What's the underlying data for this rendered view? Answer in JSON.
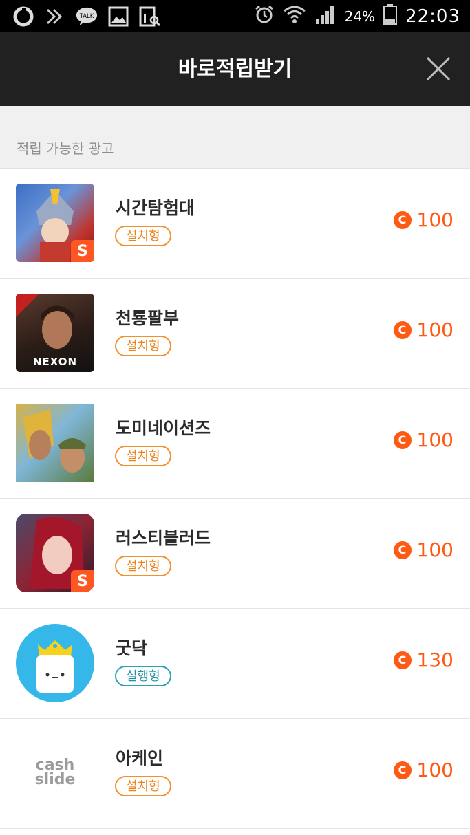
{
  "status_bar": {
    "talk_label": "TALK",
    "battery": "24%",
    "time": "22:03"
  },
  "header": {
    "title": "바로적립받기"
  },
  "section": {
    "label": "적립 가능한 광고"
  },
  "ads": [
    {
      "name": "시간탐험대",
      "type": "설치형",
      "reward": "100",
      "icon": "game-hero-icon",
      "badge_color": "orange"
    },
    {
      "name": "천룡팔부",
      "type": "설치형",
      "reward": "100",
      "icon": "nexon-game-icon",
      "brand": "NEXON",
      "badge_color": "orange"
    },
    {
      "name": "도미네이션즈",
      "type": "설치형",
      "reward": "100",
      "icon": "dominations-icon",
      "badge_color": "orange"
    },
    {
      "name": "러스티블러드",
      "type": "설치형",
      "reward": "100",
      "icon": "rusty-blood-icon",
      "badge_color": "orange"
    },
    {
      "name": "굿닥",
      "type": "실행형",
      "reward": "130",
      "icon": "goodoc-icon",
      "badge_color": "teal"
    },
    {
      "name": "아케인",
      "type": "설치형",
      "reward": "100",
      "icon": "cashslide-icon",
      "brand_line1": "cash",
      "brand_line2": "slide",
      "badge_color": "orange"
    }
  ],
  "colors": {
    "header_bg": "#212121",
    "reward": "#ff5a14",
    "install_badge": "#f0912d",
    "execute_badge": "#2aa3b4"
  }
}
